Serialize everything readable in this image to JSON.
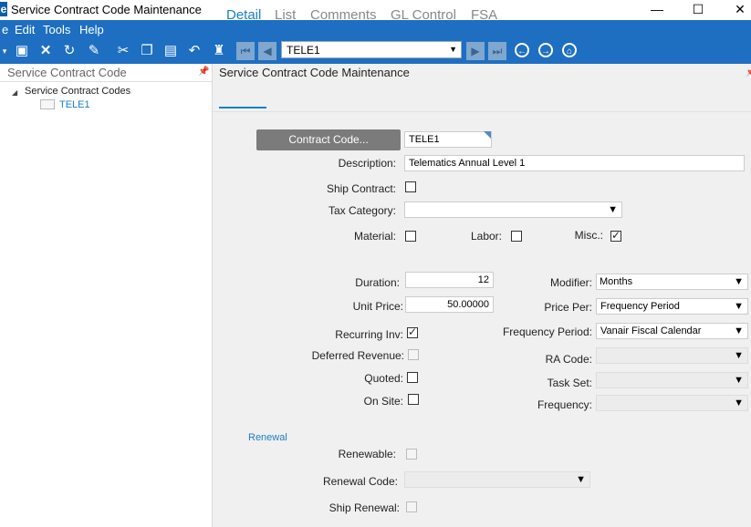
{
  "window": {
    "app_icon": "e",
    "title": "Service Contract Code Maintenance"
  },
  "menu": {
    "items": [
      "e",
      "Edit",
      "Tools",
      "Help"
    ]
  },
  "toolbar": {
    "record_value": "TELE1",
    "icons": [
      "save-icon",
      "delete-icon",
      "refresh-icon",
      "clear-icon",
      "cut-icon",
      "copy-icon",
      "paste-icon",
      "undo-icon",
      "find-icon"
    ]
  },
  "left_panel": {
    "header": "Service Contract Code",
    "tree_root": "Service Contract Codes",
    "tree_child": "TELE1"
  },
  "right_panel": {
    "header": "Service Contract Code Maintenance",
    "tabs": [
      "Detail",
      "List",
      "Comments",
      "GL Control",
      "FSA"
    ]
  },
  "form": {
    "contract_code_button": "Contract Code...",
    "contract_code_value": "TELE1",
    "description_label": "Description:",
    "description_value": "Telematics Annual Level 1",
    "ship_contract_label": "Ship Contract:",
    "tax_category_label": "Tax Category:",
    "material_label": "Material:",
    "labor_label": "Labor:",
    "misc_label": "Misc.:",
    "misc_checked": true,
    "duration_label": "Duration:",
    "duration_value": "12",
    "unit_price_label": "Unit Price:",
    "unit_price_value": "50.00000",
    "modifier_label": "Modifier:",
    "modifier_value": "Months",
    "price_per_label": "Price Per:",
    "price_per_value": "Frequency Period",
    "recurring_label": "Recurring Inv:",
    "recurring_checked": true,
    "frequency_period_label": "Frequency Period:",
    "frequency_period_value": "Vanair Fiscal Calendar",
    "deferred_label": "Deferred Revenue:",
    "ra_code_label": "RA Code:",
    "quoted_label": "Quoted:",
    "task_set_label": "Task Set:",
    "on_site_label": "On Site:",
    "frequency_label": "Frequency:",
    "renewal_header": "Renewal",
    "renewable_label": "Renewable:",
    "renewal_code_label": "Renewal Code:",
    "ship_renewal_label": "Ship Renewal:"
  },
  "colors": {
    "accent": "#1e6fc1",
    "link": "#1b7fc6",
    "button_gray": "#7b7b7b"
  }
}
